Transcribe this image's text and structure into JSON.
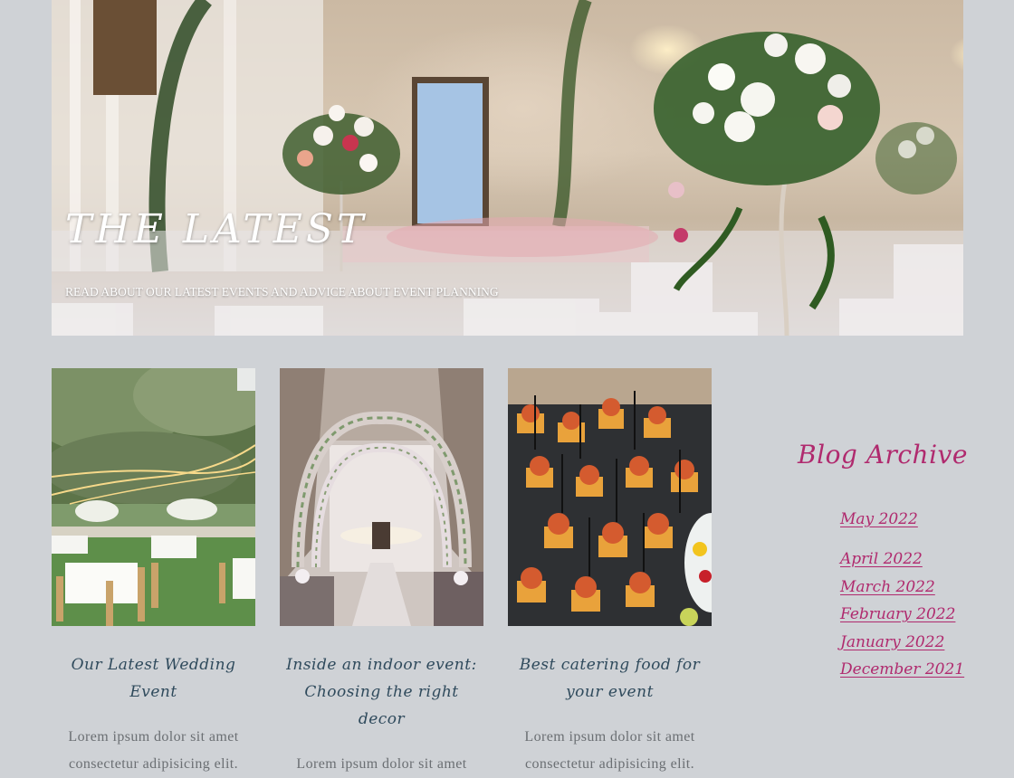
{
  "hero": {
    "title": "THE LATEST",
    "subtitle": "READ ABOUT OUR LATEST EVENTS AND ADVICE ABOUT EVENT PLANNING"
  },
  "posts": [
    {
      "title": "Our Latest Wedding Event",
      "excerpt": "Lorem ipsum dolor sit amet consectetur adipisicing elit."
    },
    {
      "title": "Inside an indoor event: Choosing the right decor",
      "excerpt": "Lorem ipsum dolor sit amet consectetur adipisicing elit."
    },
    {
      "title": "Best catering food for your event",
      "excerpt": "Lorem ipsum dolor sit amet consectetur adipisicing elit."
    }
  ],
  "sidebar": {
    "title": "Blog Archive",
    "archive": [
      {
        "label": "May 2022"
      },
      {
        "label": "April 2022"
      },
      {
        "label": "March 2022"
      },
      {
        "label": "February 2022"
      },
      {
        "label": "January 2022"
      },
      {
        "label": "December 2021"
      }
    ]
  },
  "colors": {
    "background": "#cfd2d6",
    "accent": "#b02a6e",
    "post_title": "#2f4a5c",
    "body_text": "#6b6f73"
  }
}
